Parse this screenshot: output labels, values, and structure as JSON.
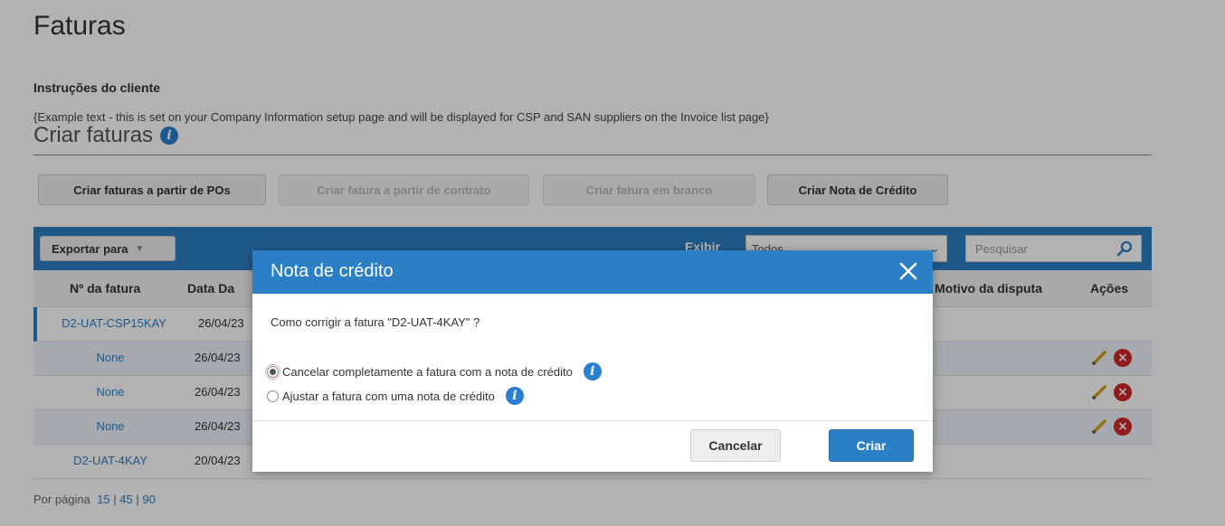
{
  "page": {
    "title": "Faturas",
    "instructions_title": "Instruções do cliente",
    "instructions_text": "{Example text - this is set on your Company Information setup page and will be displayed for CSP and SAN suppliers on the Invoice list page}",
    "section_title": "Criar faturas"
  },
  "actions": {
    "from_pos": "Criar faturas a partir de POs",
    "from_contract": "Criar fatura a partir de contrato",
    "blank": "Criar fatura em branco",
    "credit_note": "Criar Nota de Crédito"
  },
  "toolbar": {
    "export_label": "Exportar para",
    "show_label": "Exibir",
    "show_value": "Todos",
    "search_placeholder": "Pesquisar"
  },
  "table": {
    "headers": {
      "invoice_no": "Nº da fatura",
      "date": "Data Da",
      "dispute_reason": "Motivo da disputa",
      "actions": "Ações"
    },
    "rows": [
      {
        "invoice": "D2-UAT-CSP15KAY",
        "date": "26/04/23"
      },
      {
        "invoice": "None",
        "date": "26/04/23"
      },
      {
        "invoice": "None",
        "date": "26/04/23"
      },
      {
        "invoice": "None",
        "date": "26/04/23"
      },
      {
        "invoice": "D2-UAT-4KAY",
        "date": "20/04/23"
      }
    ]
  },
  "pager": {
    "label": "Por página",
    "options": [
      "15",
      "45",
      "90"
    ],
    "separator": "|"
  },
  "modal": {
    "title": "Nota de crédito",
    "question": "Como corrigir a fatura \"D2-UAT-4KAY\" ?",
    "option_cancel": "Cancelar completamente a fatura com a nota de crédito",
    "option_adjust": "Ajustar a fatura com uma nota de crédito",
    "cancel_label": "Cancelar",
    "create_label": "Criar"
  },
  "colors": {
    "accent": "#2b7fc4",
    "danger": "#d0292c"
  }
}
